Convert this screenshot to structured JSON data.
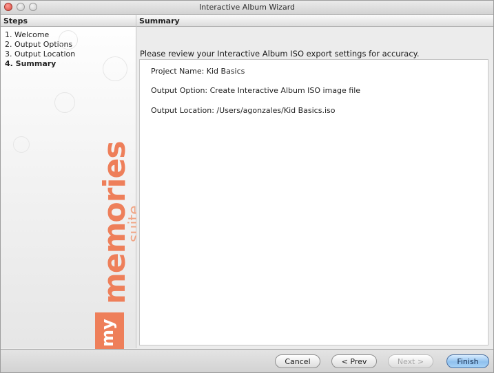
{
  "window": {
    "title": "Interactive Album Wizard"
  },
  "sidebar": {
    "header": "Steps",
    "steps": [
      "1. Welcome",
      "2. Output Options",
      "3. Output Location",
      "4. Summary"
    ],
    "logo": {
      "my": "my",
      "word": "memories",
      "suite": "suite"
    }
  },
  "main": {
    "header": "Summary",
    "review_text": "Please review your Interactive Album ISO export settings for accuracy.",
    "details": [
      "Project Name: Kid Basics",
      "Output Option: Create Interactive Album ISO image file",
      "Output Location: /Users/agonzales/Kid Basics.iso"
    ]
  },
  "buttons": {
    "cancel": "Cancel",
    "prev": "< Prev",
    "next": "Next >",
    "finish": "Finish"
  },
  "colors": {
    "logo": "#ee7f5a",
    "finish_button": "#8fc1ee"
  },
  "icons": {
    "close": "close-icon",
    "minimize": "minimize-icon",
    "zoom": "zoom-icon"
  }
}
